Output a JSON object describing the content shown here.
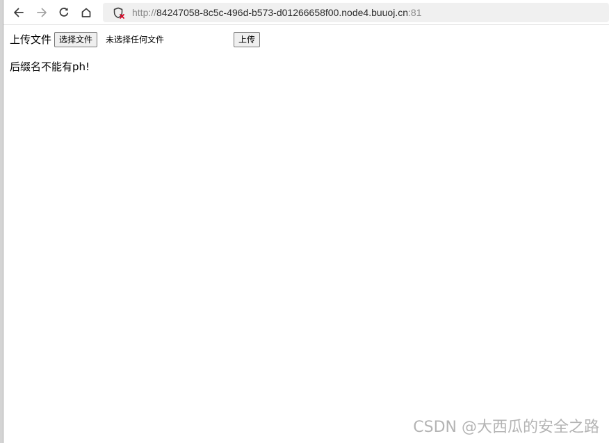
{
  "browser": {
    "url": {
      "protocol": "http://",
      "host": "84247058-8c5c-496d-b573-d01266658f00.node4.buuoj.cn",
      "port": ":81"
    },
    "icons": {
      "back": "arrow-left-icon",
      "forward": "arrow-right-icon",
      "reload": "reload-icon",
      "home": "home-icon",
      "security": "shield-warning-icon"
    }
  },
  "page": {
    "upload_label": "上传文件",
    "choose_file_button": "选择文件",
    "no_file_selected": "未选择任何文件",
    "submit_button": "上传",
    "message": "后缀名不能有ph!"
  },
  "watermark": "CSDN @大西瓜的安全之路"
}
